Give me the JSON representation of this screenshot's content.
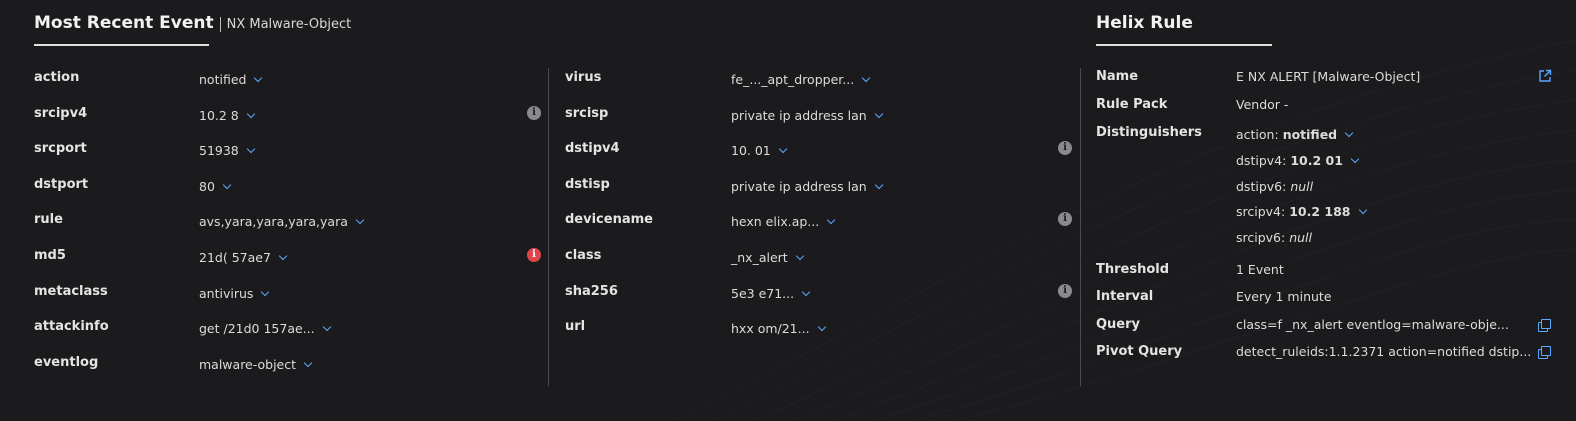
{
  "event_panel": {
    "title": "Most Recent Event",
    "subtitle": "NX Malware-Object",
    "left_fields": [
      {
        "key": "action",
        "value": "notified"
      },
      {
        "key": "srcipv4",
        "value": "10.2          8"
      },
      {
        "key": "srcport",
        "value": "51938"
      },
      {
        "key": "dstport",
        "value": "80"
      },
      {
        "key": "rule",
        "value": "avs,yara,yara,yara,yara"
      },
      {
        "key": "md5",
        "value": "21d(                                  57ae7"
      },
      {
        "key": "metaclass",
        "value": "antivirus"
      },
      {
        "key": "attackinfo",
        "value": "get /21d0                         157ae..."
      },
      {
        "key": "eventlog",
        "value": "malware-object"
      }
    ],
    "right_fields": [
      {
        "key": "virus",
        "value": "fe_..._apt_dropper..."
      },
      {
        "key": "srcisp",
        "value": "private ip address lan"
      },
      {
        "key": "dstipv4",
        "value": "10.        01"
      },
      {
        "key": "dstisp",
        "value": "private ip address lan"
      },
      {
        "key": "devicename",
        "value": "hexn                    elix.ap..."
      },
      {
        "key": "class",
        "value": "       _nx_alert"
      },
      {
        "key": "sha256",
        "value": "5e3                         e71..."
      },
      {
        "key": "url",
        "value": "hxx                           om/21..."
      }
    ]
  },
  "rule_panel": {
    "title": "Helix Rule",
    "name_label": "Name",
    "name_value": "E NX ALERT [Malware-Object]",
    "rule_pack_label": "Rule Pack",
    "rule_pack_value": "Vendor -",
    "distinguishers_label": "Distinguishers",
    "distinguishers": [
      {
        "key": "action:",
        "value": "notified",
        "chevron": true,
        "null": false
      },
      {
        "key": "dstipv4:",
        "value": "10.2           01",
        "chevron": true,
        "null": false
      },
      {
        "key": "dstipv6:",
        "value": "null",
        "chevron": false,
        "null": true
      },
      {
        "key": "srcipv4:",
        "value": "10.2          188",
        "chevron": true,
        "null": false
      },
      {
        "key": "srcipv6:",
        "value": "null",
        "chevron": false,
        "null": true
      }
    ],
    "threshold_label": "Threshold",
    "threshold_value": "1 Event",
    "interval_label": "Interval",
    "interval_value": "Every 1 minute",
    "query_label": "Query",
    "query_value": "class=f      _nx_alert eventlog=malware-obje...",
    "pivot_label": "Pivot Query",
    "pivot_value": "detect_ruleids:1.1.2371 action=notified dstip..."
  },
  "colors": {
    "background": "#1b1b1d",
    "accent": "#5aa9ff",
    "danger": "#e0454b"
  }
}
